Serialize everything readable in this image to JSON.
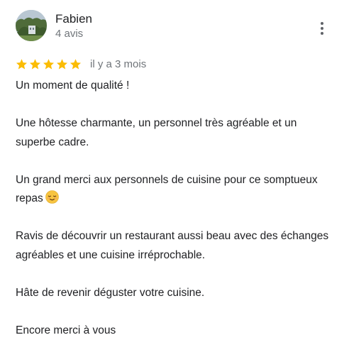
{
  "review": {
    "author": {
      "name": "Fabien",
      "meta": "4 avis"
    },
    "rating": {
      "stars": 5,
      "max": 5,
      "star_color": "#fbbc04"
    },
    "date": "il y a 3 mois",
    "paragraphs": [
      "Un moment de qualité !",
      "Une hôtesse charmante, un personnel très agréable et un superbe cadre.",
      "Un grand merci aux personnels de cuisine pour ce somptueux repas",
      "Ravis de découvrir un restaurant aussi beau avec des échanges agréables et une cuisine irréprochable.",
      "Hâte de revenir déguster votre cuisine.",
      "Encore merci à vous"
    ],
    "emoji": "relieved-face-icon"
  }
}
